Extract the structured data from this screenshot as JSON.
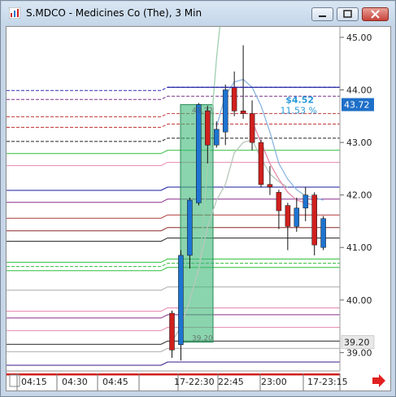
{
  "window": {
    "title": "S.MDCO - Medicines Co (The), 3 Min"
  },
  "icons": {
    "app": "chart-app-icon",
    "minimize": "minimize-icon",
    "maximize": "maximize-icon",
    "close": "close-icon",
    "scroll": "scroll-right-arrow-icon"
  },
  "colors": {
    "up_candle": "#1e74d0",
    "down_candle": "#d0201e",
    "selection": "#3cb878",
    "annotation": "#2a9ad8",
    "price_tag_bg": "#1e6fc8"
  },
  "price_axis": {
    "ticks": [
      "45.00",
      "44.00",
      "43.00",
      "42.00",
      "41.00",
      "40.00",
      "39.00"
    ],
    "current_price": "43.72",
    "marker_price": "39.20"
  },
  "time_axis": {
    "ticks": [
      "04:15",
      "04:30",
      "04:45",
      "17-22:30",
      "22:45",
      "23:00",
      "17-23:15"
    ]
  },
  "annotation": {
    "change": "$4.52",
    "percent": "11.53 %",
    "top_label": "43.72",
    "bottom_label": "39.20"
  },
  "chart_data": {
    "type": "candlestick",
    "ylim": [
      38.65,
      45.2
    ],
    "candles": [
      {
        "o": 39.75,
        "h": 39.8,
        "l": 38.9,
        "c": 39.05
      },
      {
        "o": 39.15,
        "h": 40.95,
        "l": 38.85,
        "c": 40.85
      },
      {
        "o": 40.85,
        "h": 41.95,
        "l": 40.6,
        "c": 41.9
      },
      {
        "o": 41.85,
        "h": 43.75,
        "l": 41.8,
        "c": 43.72
      },
      {
        "o": 43.6,
        "h": 43.7,
        "l": 42.6,
        "c": 42.95
      },
      {
        "o": 42.95,
        "h": 43.4,
        "l": 42.9,
        "c": 43.25
      },
      {
        "o": 43.2,
        "h": 44.1,
        "l": 42.95,
        "c": 44.0
      },
      {
        "o": 44.05,
        "h": 44.35,
        "l": 43.5,
        "c": 43.6
      },
      {
        "o": 43.6,
        "h": 44.85,
        "l": 43.45,
        "c": 43.55
      },
      {
        "o": 43.55,
        "h": 43.8,
        "l": 42.85,
        "c": 43.0
      },
      {
        "o": 43.0,
        "h": 43.05,
        "l": 42.15,
        "c": 42.2
      },
      {
        "o": 42.2,
        "h": 42.55,
        "l": 42.0,
        "c": 42.15
      },
      {
        "o": 42.05,
        "h": 42.1,
        "l": 41.35,
        "c": 41.7
      },
      {
        "o": 41.8,
        "h": 41.85,
        "l": 40.95,
        "c": 41.4
      },
      {
        "o": 41.4,
        "h": 41.95,
        "l": 41.3,
        "c": 41.75
      },
      {
        "o": 41.75,
        "h": 42.15,
        "l": 41.5,
        "c": 42.0
      },
      {
        "o": 42.0,
        "h": 42.05,
        "l": 40.85,
        "c": 41.05
      },
      {
        "o": 41.0,
        "h": 41.6,
        "l": 40.95,
        "c": 41.55
      }
    ],
    "level_lines": [
      {
        "price": 44.05,
        "color": "#2b2bb5",
        "dash": true
      },
      {
        "price": 43.88,
        "color": "#7a2f8a",
        "dash": true
      },
      {
        "price": 43.55,
        "color": "#c43a3a",
        "dash": true
      },
      {
        "price": 43.35,
        "color": "#c43a3a",
        "dash": true
      },
      {
        "price": 43.08,
        "color": "#222222",
        "dash": true
      },
      {
        "price": 42.85,
        "color": "#2fbf3a",
        "dash": false
      },
      {
        "price": 42.62,
        "color": "#e48ab0",
        "dash": false
      },
      {
        "price": 42.15,
        "color": "#1a1aa0",
        "dash": false
      },
      {
        "price": 41.92,
        "color": "#8a2f8a",
        "dash": false
      },
      {
        "price": 41.62,
        "color": "#b03a3a",
        "dash": false
      },
      {
        "price": 41.38,
        "color": "#8a2a2a",
        "dash": false
      },
      {
        "price": 41.18,
        "color": "#222222",
        "dash": false
      },
      {
        "price": 40.78,
        "color": "#2fbf3a",
        "dash": false
      },
      {
        "price": 40.7,
        "color": "#2fbf3a",
        "dash": true
      },
      {
        "price": 40.62,
        "color": "#2fbf3a",
        "dash": false
      },
      {
        "price": 40.25,
        "color": "#aaaaaa",
        "dash": false
      },
      {
        "price": 39.85,
        "color": "#e48ab0",
        "dash": false
      },
      {
        "price": 39.72,
        "color": "#8a2f8a",
        "dash": false
      },
      {
        "price": 39.48,
        "color": "#e48ab0",
        "dash": false
      },
      {
        "price": 39.22,
        "color": "#222222",
        "dash": false
      },
      {
        "price": 39.08,
        "color": "#aaaaaa",
        "dash": false
      },
      {
        "price": 38.82,
        "color": "#3a1a8a",
        "dash": false
      }
    ],
    "ma_fast": [
      {
        "i": 9,
        "p": 43.4
      },
      {
        "i": 10,
        "p": 43.0
      },
      {
        "i": 11,
        "p": 42.6
      },
      {
        "i": 12,
        "p": 42.3
      },
      {
        "i": 13,
        "p": 42.05
      },
      {
        "i": 14,
        "p": 41.9
      },
      {
        "i": 15,
        "p": 41.85
      },
      {
        "i": 16,
        "p": 41.8
      }
    ],
    "ma_blue": [
      {
        "i": 5,
        "p": 43.3
      },
      {
        "i": 6,
        "p": 43.9
      },
      {
        "i": 7,
        "p": 44.15
      },
      {
        "i": 8,
        "p": 44.2
      },
      {
        "i": 9,
        "p": 44.05
      },
      {
        "i": 10,
        "p": 43.7
      },
      {
        "i": 11,
        "p": 43.2
      },
      {
        "i": 12,
        "p": 42.6
      },
      {
        "i": 13,
        "p": 42.3
      },
      {
        "i": 14,
        "p": 42.1
      },
      {
        "i": 15,
        "p": 41.98
      },
      {
        "i": 16,
        "p": 41.95
      },
      {
        "i": 17,
        "p": 41.9
      }
    ],
    "ma_gray": [
      {
        "i": 0,
        "p": 39.2
      },
      {
        "i": 1,
        "p": 39.5
      },
      {
        "i": 2,
        "p": 40.0
      },
      {
        "i": 3,
        "p": 40.6
      },
      {
        "i": 4,
        "p": 41.4
      },
      {
        "i": 5,
        "p": 41.9
      },
      {
        "i": 6,
        "p": 42.2
      },
      {
        "i": 7,
        "p": 42.8
      },
      {
        "i": 8,
        "p": 43.0
      },
      {
        "i": 9,
        "p": 43.05
      },
      {
        "i": 10,
        "p": 42.7
      },
      {
        "i": 11,
        "p": 42.4
      },
      {
        "i": 12,
        "p": 42.25
      },
      {
        "i": 13,
        "p": 42.15
      }
    ],
    "ma_green_steep": [
      {
        "i": 3,
        "p": 40.5
      },
      {
        "i": 4,
        "p": 42.5
      },
      {
        "i": 5,
        "p": 44.6
      },
      {
        "i": 5.5,
        "p": 45.4
      }
    ]
  }
}
